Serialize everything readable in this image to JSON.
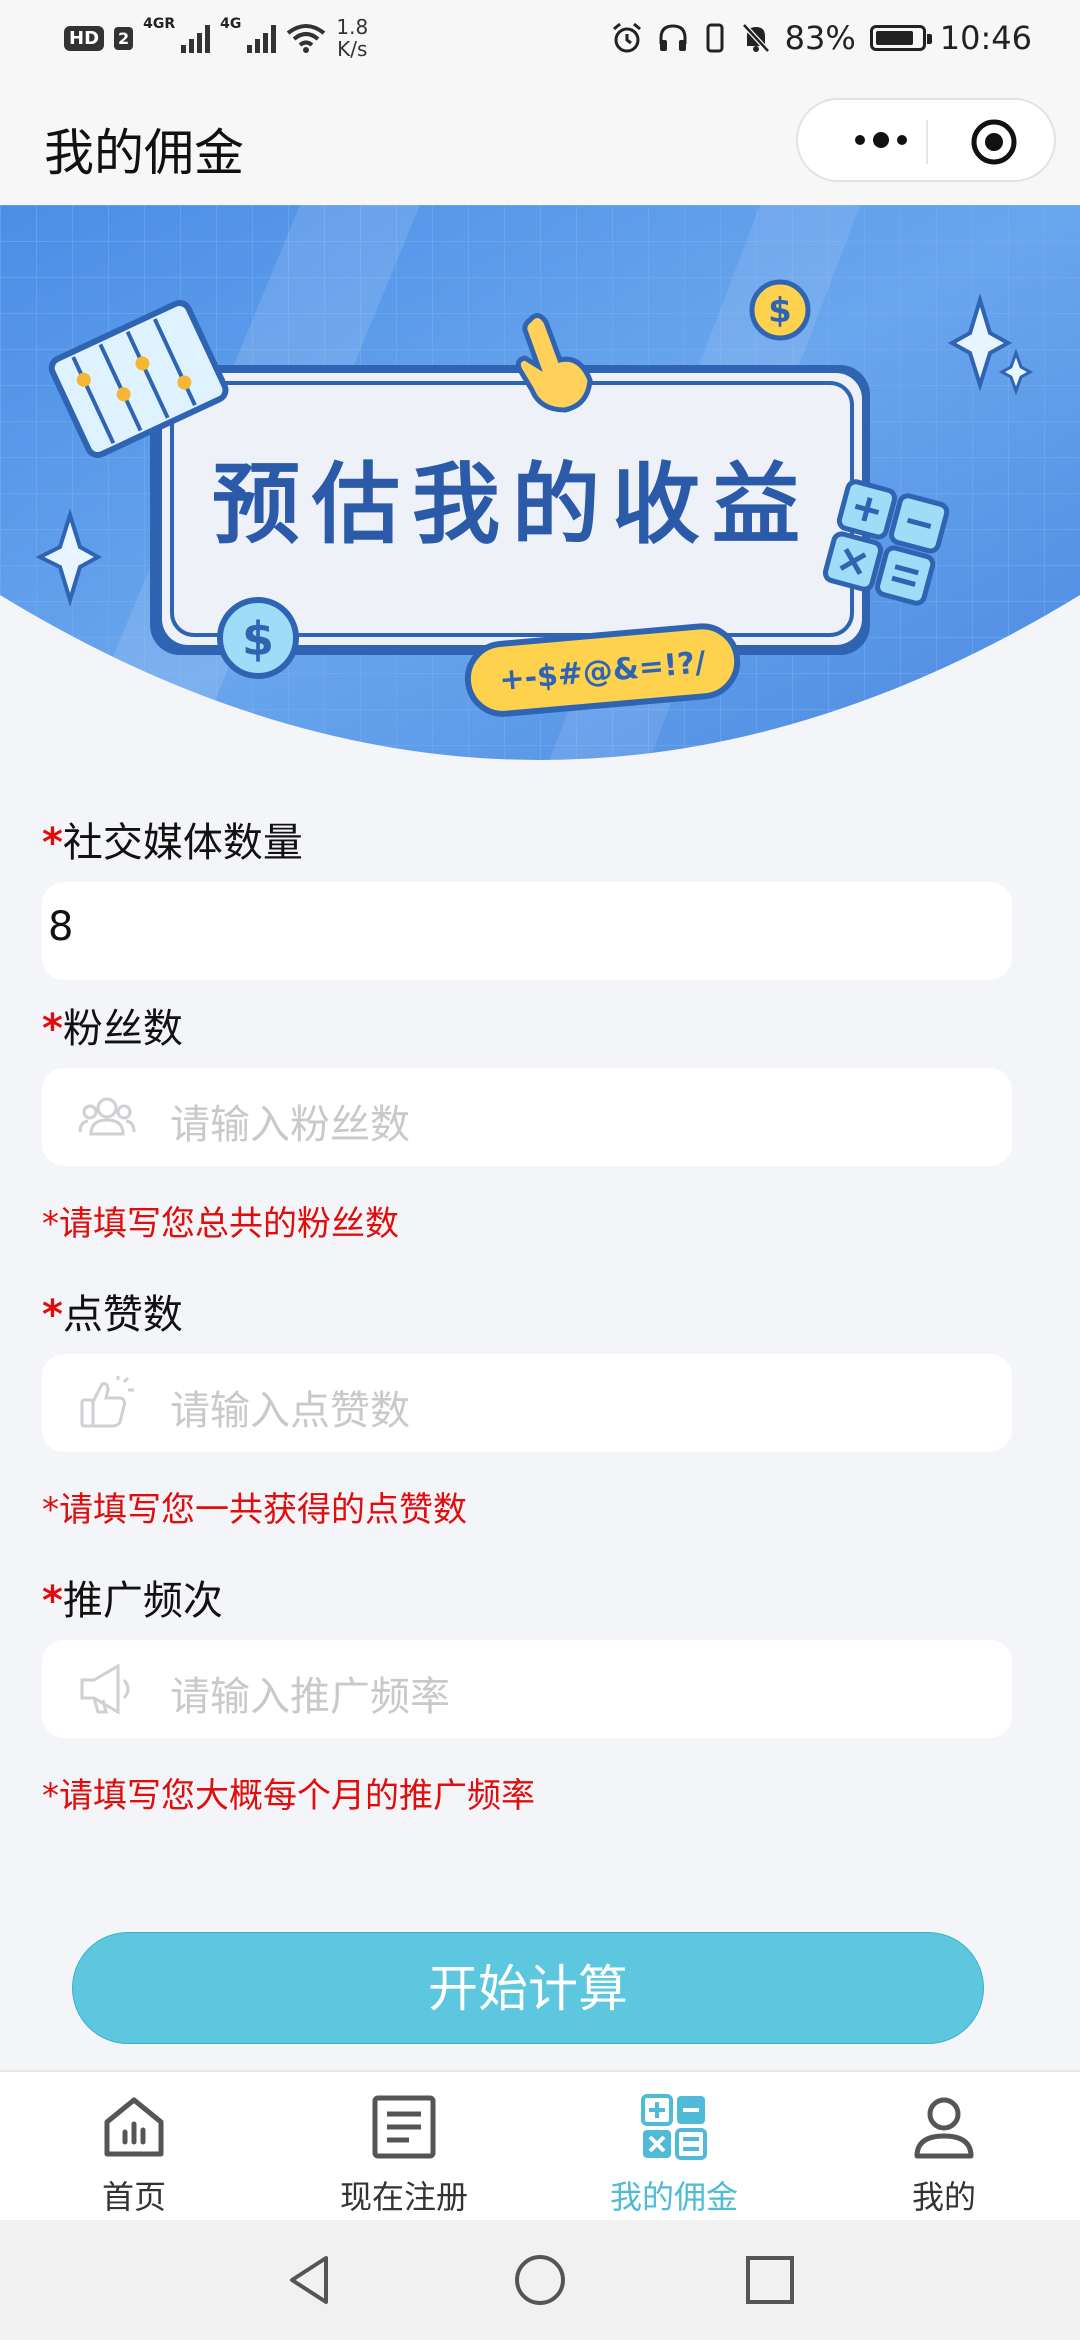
{
  "status_bar": {
    "hd": "HD",
    "sim": "2",
    "net1": "4G",
    "net1_sup": "R",
    "net2": "4G",
    "speed_value": "1.8",
    "speed_unit": "K/s",
    "battery": "83%",
    "battery_level": 0.83,
    "time": "10:46"
  },
  "nav": {
    "title": "我的佣金"
  },
  "banner": {
    "title": "预估我的收益",
    "symbols": "+-$#@&=!?/",
    "dollar": "$"
  },
  "form": {
    "required_mark": "*",
    "fields": [
      {
        "label": "社交媒体数量",
        "value": "8"
      },
      {
        "label": "粉丝数",
        "placeholder": "请输入粉丝数",
        "hint": "*请填写您总共的粉丝数",
        "icon": "people-icon"
      },
      {
        "label": "点赞数",
        "placeholder": "请输入点赞数",
        "hint": "*请填写您一共获得的点赞数",
        "icon": "thumbs-up-icon"
      },
      {
        "label": "推广频次",
        "placeholder": "请输入推广频率",
        "hint": "*请填写您大概每个月的推广频率",
        "icon": "megaphone-icon"
      }
    ]
  },
  "button": {
    "calculate": "开始计算"
  },
  "tabs": [
    {
      "label": "首页",
      "icon": "home-chart-icon"
    },
    {
      "label": "现在注册",
      "icon": "document-icon"
    },
    {
      "label": "我的佣金",
      "icon": "calculator-icon",
      "active": true
    },
    {
      "label": "我的",
      "icon": "person-icon"
    }
  ],
  "colors": {
    "accent": "#5cc7df",
    "active_tab": "#4fbbd8",
    "required": "#e10c0c",
    "banner_blue": "#4a8de6"
  }
}
